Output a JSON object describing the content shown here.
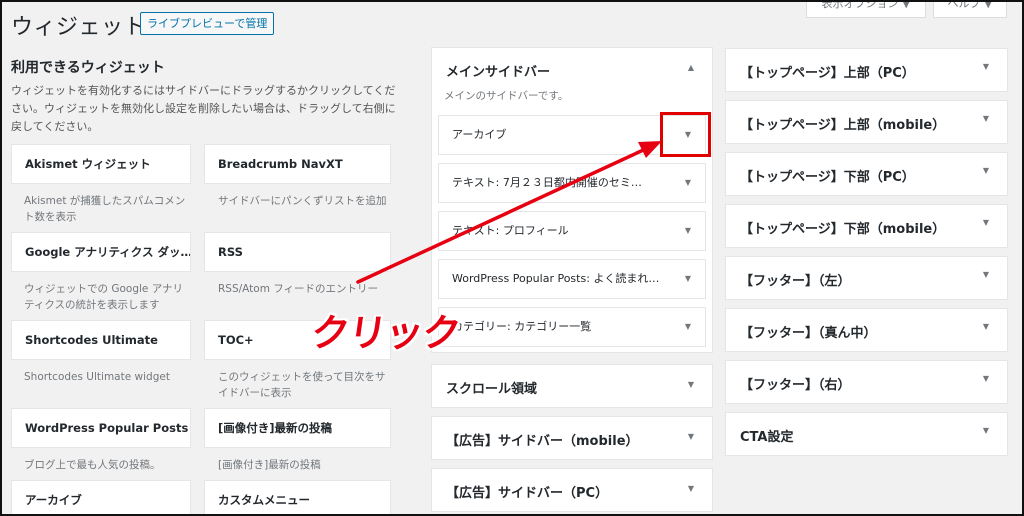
{
  "header": {
    "title": "ウィジェット",
    "live_preview_button": "ライブプレビューで管理",
    "screen_options": "表示オプション ▼",
    "help": "ヘルプ ▼"
  },
  "available": {
    "title": "利用できるウィジェット",
    "description": "ウィジェットを有効化するにはサイドバーにドラッグするかクリックしてください。ウィジェットを無効化し設定を削除したい場合は、ドラッグして右側に戻してください。",
    "widgets": [
      {
        "name": "Akismet ウィジェット",
        "desc": "Akismet が捕獲したスパムコメント数を表示"
      },
      {
        "name": "Breadcrumb NavXT",
        "desc": "サイドバーにパンくずリストを追加"
      },
      {
        "name": "Google アナリティクス ダッ…",
        "desc": "ウィジェットでの Google アナリティクスの統計を表示します"
      },
      {
        "name": "RSS",
        "desc": "RSS/Atom フィードのエントリー"
      },
      {
        "name": "Shortcodes Ultimate",
        "desc": "Shortcodes Ultimate widget"
      },
      {
        "name": "TOC+",
        "desc": "このウィジェットを使って目次をサイドバーに表示"
      },
      {
        "name": "WordPress Popular Posts",
        "desc": "ブログ上で最も人気の投稿。"
      },
      {
        "name": "[画像付き]最新の投稿",
        "desc": "[画像付き]最新の投稿"
      },
      {
        "name": "アーカイブ",
        "desc": ""
      },
      {
        "name": "カスタムメニュー",
        "desc": ""
      }
    ]
  },
  "main_sidebar": {
    "title": "メインサイドバー",
    "description": "メインのサイドバーです。",
    "widgets": [
      "アーカイブ",
      "テキスト: 7月２３日都内開催のセミ…",
      "テキスト: プロフィール",
      "WordPress Popular Posts: よく読まれ…",
      "カテゴリー: カテゴリー一覧"
    ]
  },
  "middle_areas": [
    "スクロール領域",
    "【広告】サイドバー（mobile）",
    "【広告】サイドバー（PC）"
  ],
  "right_areas": [
    "【トップページ】上部（PC）",
    "【トップページ】上部（mobile）",
    "【トップページ】下部（PC）",
    "【トップページ】下部（mobile）",
    "【フッター】（左）",
    "【フッター】（真ん中）",
    "【フッター】（右）",
    "CTA設定"
  ],
  "annotation": {
    "label": "クリック",
    "color": "#e60012"
  },
  "icons": {
    "expand": "▼",
    "collapse": "▲"
  }
}
